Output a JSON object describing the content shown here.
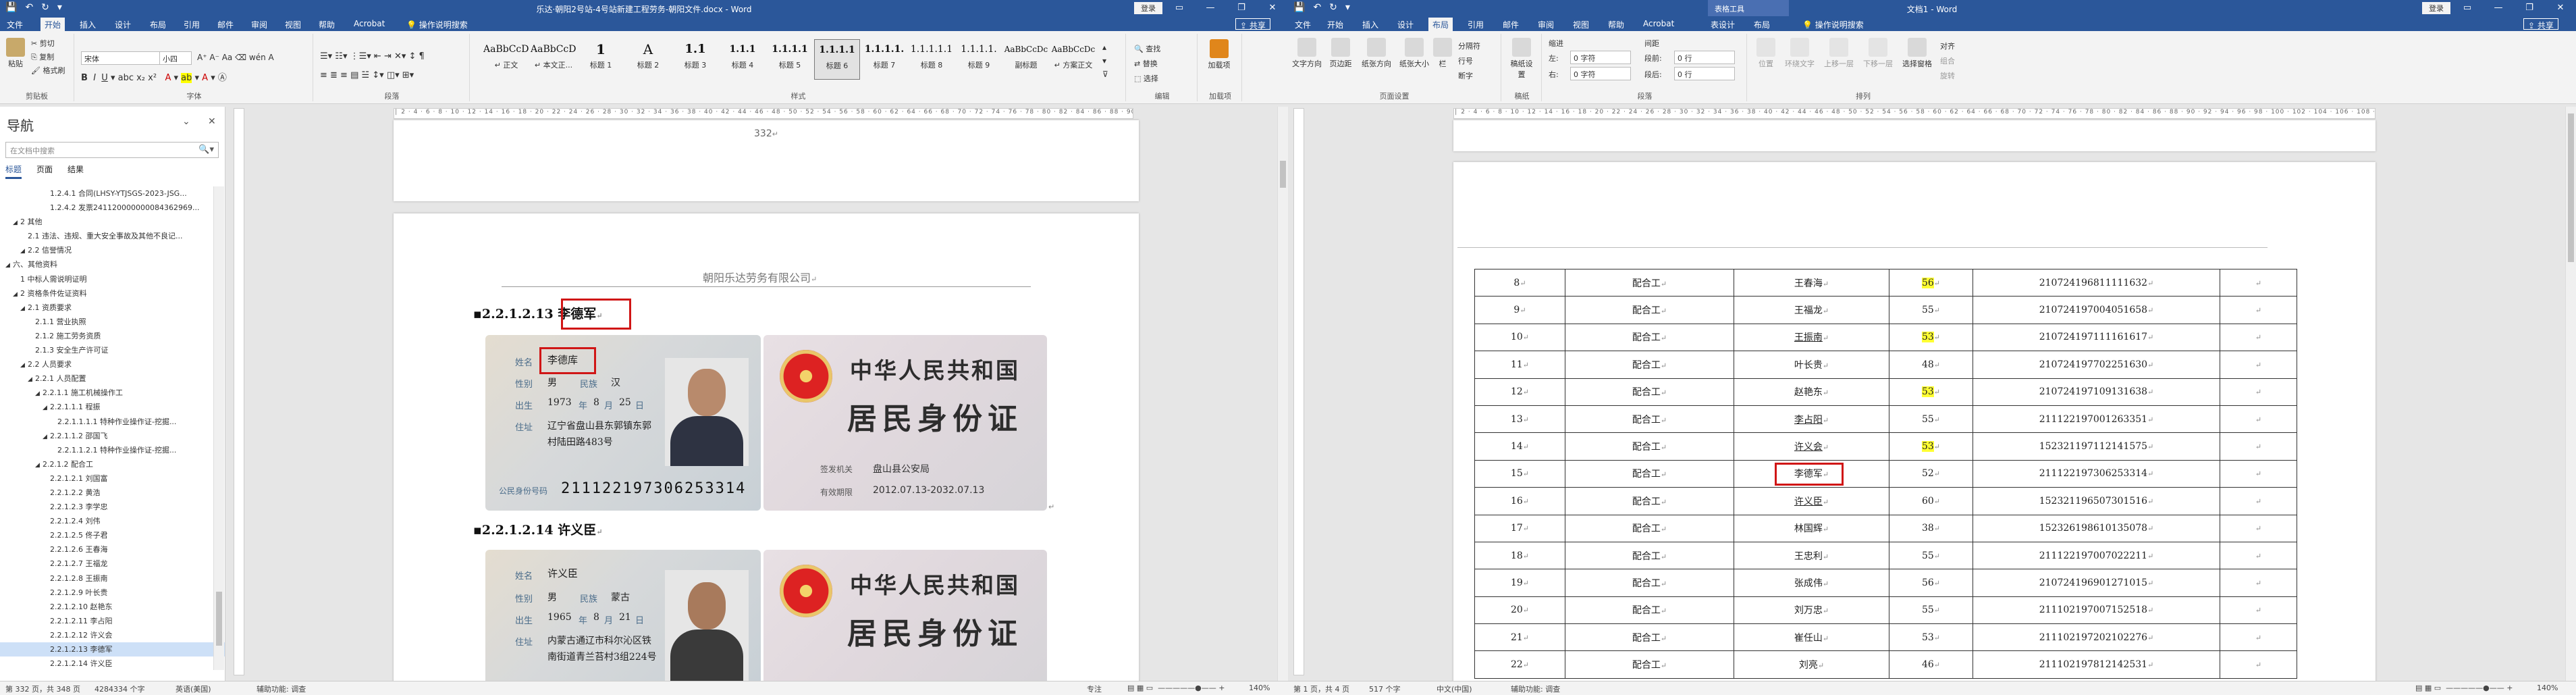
{
  "win1": {
    "title": "乐达·朝阳2号站-4号站新建工程劳务-朝阳文件.docx - Word",
    "login": "登录",
    "share": "共享",
    "tabs": [
      "文件",
      "开始",
      "插入",
      "设计",
      "布局",
      "引用",
      "邮件",
      "审阅",
      "视图",
      "帮助",
      "Acrobat"
    ],
    "tell_me": "操作说明搜索",
    "clipboard": {
      "paste": "粘贴",
      "cut": "剪切",
      "copy": "复制",
      "format_painter": "格式刷",
      "label": "剪贴板"
    },
    "font": {
      "name": "宋体",
      "size": "小四",
      "label": "字体"
    },
    "paragraph_label": "段落",
    "styles": [
      {
        "pv": "AaBbCcDdE",
        "nm": "↵ 正文"
      },
      {
        "pv": "AaBbCcDdE",
        "nm": "↵ 本文正..."
      },
      {
        "pv": "1",
        "nm": "标题 1"
      },
      {
        "pv": "A",
        "nm": "标题 2"
      },
      {
        "pv": "1.1",
        "nm": "标题 3"
      },
      {
        "pv": "1.1.1",
        "nm": "标题 4"
      },
      {
        "pv": "1.1.1.1",
        "nm": "标题 5"
      },
      {
        "pv": "1.1.1.1",
        "nm": "标题 6"
      },
      {
        "pv": "1.1.1.1.",
        "nm": "标题 7"
      },
      {
        "pv": "1.1.1.1.1",
        "nm": "标题 8"
      },
      {
        "pv": "1.1.1.1.",
        "nm": "标题 9"
      },
      {
        "pv": "AaBbCcDc",
        "nm": "副标题"
      },
      {
        "pv": "AaBbCcDc",
        "nm": "↵ 方案正文"
      }
    ],
    "styles_label": "样式",
    "editing": {
      "find": "查找",
      "replace": "替换",
      "select": "选择",
      "label": "编辑"
    },
    "addin": {
      "label": "加载项",
      "btn": "加载项"
    },
    "nav": {
      "title": "导航",
      "search_placeholder": "在文档中搜索",
      "tabs": [
        "标题",
        "页面",
        "结果"
      ],
      "items": [
        {
          "t": "1.2.4.1 合同(LHSY-YTJSGS-2023-JSG...",
          "lvl": 5
        },
        {
          "t": "1.2.4.2 发票241120000000084362969...",
          "lvl": 5
        },
        {
          "t": "2 其他",
          "lvl": 1,
          "exp": true
        },
        {
          "t": "2.1 违法、违规、重大安全事故及其他不良记...",
          "lvl": 2
        },
        {
          "t": "2.2 信誉情况",
          "lvl": 2,
          "exp": true
        },
        {
          "t": "六、其他资料",
          "lvl": 0,
          "exp": true
        },
        {
          "t": "1 中标人需说明证明",
          "lvl": 1
        },
        {
          "t": "2 资格条件佐证资料",
          "lvl": 1,
          "exp": true
        },
        {
          "t": "2.1 资质要求",
          "lvl": 2,
          "exp": true
        },
        {
          "t": "2.1.1 营业执照",
          "lvl": 3
        },
        {
          "t": "2.1.2 施工劳务资质",
          "lvl": 3
        },
        {
          "t": "2.1.3 安全生产许可证",
          "lvl": 3
        },
        {
          "t": "2.2 人员要求",
          "lvl": 2,
          "exp": true
        },
        {
          "t": "2.2.1 人员配置",
          "lvl": 3,
          "exp": true
        },
        {
          "t": "2.2.1.1 施工机械操作工",
          "lvl": 4,
          "exp": true
        },
        {
          "t": "2.2.1.1.1 程振",
          "lvl": 5,
          "exp": true
        },
        {
          "t": "2.2.1.1.1.1 特种作业操作证-挖掘...",
          "lvl": 6
        },
        {
          "t": "2.2.1.1.2 邵国飞",
          "lvl": 5,
          "exp": true
        },
        {
          "t": "2.2.1.1.2.1 特种作业操作证-挖掘...",
          "lvl": 6
        },
        {
          "t": "2.2.1.2 配合工",
          "lvl": 4,
          "exp": true
        },
        {
          "t": "2.2.1.2.1 刘国富",
          "lvl": 5
        },
        {
          "t": "2.2.1.2.2 黄浩",
          "lvl": 5
        },
        {
          "t": "2.2.1.2.3 李学忠",
          "lvl": 5
        },
        {
          "t": "2.2.1.2.4 刘伟",
          "lvl": 5
        },
        {
          "t": "2.2.1.2.5 佟子君",
          "lvl": 5
        },
        {
          "t": "2.2.1.2.6 王春海",
          "lvl": 5
        },
        {
          "t": "2.2.1.2.7 王福龙",
          "lvl": 5
        },
        {
          "t": "2.2.1.2.8 王振南",
          "lvl": 5
        },
        {
          "t": "2.2.1.2.9 叶长贵",
          "lvl": 5
        },
        {
          "t": "2.2.1.2.10 赵艳东",
          "lvl": 5
        },
        {
          "t": "2.2.1.2.11 李占阳",
          "lvl": 5
        },
        {
          "t": "2.2.1.2.12 许义会",
          "lvl": 5
        },
        {
          "t": "2.2.1.2.13 李德军",
          "lvl": 5,
          "sel": true
        },
        {
          "t": "2.2.1.2.14 许义臣",
          "lvl": 5
        }
      ]
    },
    "page_number": "332",
    "header_company": "朝阳乐达劳务有限公司",
    "heading1": "2.2.1.2.13 李德军",
    "heading2": "2.2.1.2.14 许义臣",
    "card1": {
      "labels": {
        "name": "姓名",
        "sex": "性别",
        "nation": "民族",
        "birth": "出生",
        "addr": "住址",
        "num": "公民身份号码",
        "year": "年",
        "month": "月",
        "day": "日"
      },
      "name": "李德库",
      "sex": "男",
      "nation": "汉",
      "y": "1973",
      "m": "8",
      "d": "25",
      "addr1": "辽宁省盘山县东郭镇东郭",
      "addr2": "村陆田路483号",
      "num": "211122197306253314",
      "back_title1": "中华人民共和国",
      "back_title2": "居民身份证",
      "auth_lbl": "签发机关",
      "auth": "盘山县公安局",
      "valid_lbl": "有效期限",
      "valid": "2012.07.13-2032.07.13"
    },
    "card2": {
      "name": "许义臣",
      "sex": "男",
      "nation": "蒙古",
      "y": "1965",
      "m": "8",
      "d": "21",
      "addr1": "内蒙古通辽市科尔沁区铁",
      "addr2": "南街道青兰苔村3组224号",
      "back_title1": "中华人民共和国",
      "back_title2": "居民身份证"
    },
    "status": {
      "page": "第 332 页，共 348 页",
      "words": "4284334 个字",
      "lang": "英语(美国)",
      "access": "辅助功能: 调查",
      "focus": "专注",
      "zoom": "140%"
    }
  },
  "win2": {
    "title": "文档1 - Word",
    "ctx": "表格工具",
    "login": "登录",
    "share": "共享",
    "tabs": [
      "文件",
      "开始",
      "插入",
      "设计",
      "布局",
      "引用",
      "邮件",
      "审阅",
      "视图",
      "帮助",
      "Acrobat",
      "表设计",
      "布局"
    ],
    "tell_me": "操作说明搜索",
    "page_setup": {
      "items": [
        "文字方向",
        "页边距",
        "纸张方向",
        "纸张大小",
        "栏"
      ],
      "sub": [
        "分隔符",
        "行号",
        "断字"
      ],
      "label": "页面设置"
    },
    "manuscript": {
      "btn": "稿纸设置",
      "label": "稿纸"
    },
    "indent": {
      "title": "缩进",
      "left": "左:",
      "left_val": "0 字符",
      "right": "右:",
      "right_val": "0 字符"
    },
    "spacing": {
      "title": "间距",
      "before": "段前:",
      "before_val": "0 行",
      "after": "段后:",
      "after_val": "0 行"
    },
    "paragraph_label": "段落",
    "arrange": {
      "items": [
        "位置",
        "环绕文字",
        "上移一层",
        "下移一层",
        "选择窗格"
      ],
      "sub": [
        "对齐",
        "组合",
        "旋转"
      ],
      "label": "排列"
    },
    "table": {
      "rows": [
        {
          "n": "8",
          "job": "配合工",
          "name": "王春海",
          "age": "56",
          "id": "210724196811111632",
          "hl": true
        },
        {
          "n": "9",
          "job": "配合工",
          "name": "王福龙",
          "age": "55",
          "id": "210724197004051658"
        },
        {
          "n": "10",
          "job": "配合工",
          "name": "王振南",
          "age": "53",
          "id": "210724197111161617",
          "hl": true,
          "u": true
        },
        {
          "n": "11",
          "job": "配合工",
          "name": "叶长贵",
          "age": "48",
          "id": "210724197702251630"
        },
        {
          "n": "12",
          "job": "配合工",
          "name": "赵艳东",
          "age": "53",
          "id": "210724197109131638",
          "hl": true
        },
        {
          "n": "13",
          "job": "配合工",
          "name": "李占阳",
          "age": "55",
          "id": "211122197001263351",
          "u": true
        },
        {
          "n": "14",
          "job": "配合工",
          "name": "许义会",
          "age": "53",
          "id": "152321197112141575",
          "hl": true,
          "u": true
        },
        {
          "n": "15",
          "job": "配合工",
          "name": "李德军",
          "age": "52",
          "id": "211122197306253314",
          "box": true
        },
        {
          "n": "16",
          "job": "配合工",
          "name": "许义臣",
          "age": "60",
          "id": "152321196507301516",
          "u": true
        },
        {
          "n": "17",
          "job": "配合工",
          "name": "林国辉",
          "age": "38",
          "id": "152326198610135078"
        },
        {
          "n": "18",
          "job": "配合工",
          "name": "王忠利",
          "age": "55",
          "id": "211122197007022211"
        },
        {
          "n": "19",
          "job": "配合工",
          "name": "张成伟",
          "age": "56",
          "id": "210724196901271015"
        },
        {
          "n": "20",
          "job": "配合工",
          "name": "刘万忠",
          "age": "55",
          "id": "211102197007152518"
        },
        {
          "n": "21",
          "job": "配合工",
          "name": "崔任山",
          "age": "53",
          "id": "211102197202102276"
        },
        {
          "n": "22",
          "job": "配合工",
          "name": "刘亮",
          "age": "46",
          "id": "211102197812142531"
        }
      ]
    },
    "status": {
      "page": "第 1 页，共 4 页",
      "words": "517 个字",
      "lang": "中文(中国)",
      "access": "辅助功能: 调查",
      "zoom": "140%"
    }
  },
  "colors": {
    "accent": "#2b579a",
    "highlight": "#ffff33",
    "redbox": "#d01616"
  }
}
